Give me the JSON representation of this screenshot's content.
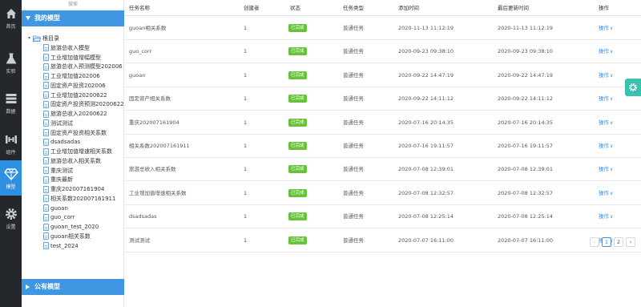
{
  "nav": [
    {
      "label": "首页",
      "icon": "home-icon"
    },
    {
      "label": "实验",
      "icon": "flask-icon"
    },
    {
      "label": "数据",
      "icon": "database-icon"
    },
    {
      "label": "组件",
      "icon": "components-icon"
    },
    {
      "label": "模型",
      "icon": "diamond-icon"
    },
    {
      "label": "设置",
      "icon": "gear-icon"
    }
  ],
  "tree": {
    "search_placeholder": "搜索",
    "my_models_label": "我的模型",
    "root_label": "根目录",
    "nodes": [
      "旅游总收入模型",
      "工业增加值增幅模型",
      "旅游总收入预测模型202006",
      "工业增加值202006",
      "固定资产投资202006",
      "工业增加值20200622",
      "固定资产投资预测20200622",
      "旅游总收入20200622",
      "测试测试",
      "固定资产投资相关系数",
      "dsadsadas",
      "工业增加值增速相关系数",
      "旅游总收入相关系数",
      "重庆测试",
      "重庆最新",
      "重庆202007161904",
      "相关系数202007161911",
      "guoan",
      "guo_corr",
      "guoan_test_2020",
      "guoan相关系数",
      "test_2024"
    ],
    "public_models_label": "公有模型"
  },
  "table": {
    "headers": [
      "任务名称",
      "创建者",
      "状态",
      "任务类型",
      "添加时间",
      "最后更新时间",
      "操作"
    ],
    "rows": [
      {
        "name": "guoan相关系数",
        "creator": "1",
        "status": "已完成",
        "type": "普通任务",
        "added": "2020-11-13 11:12:19",
        "updated": "2020-11-13 11:12:19",
        "op": "操作"
      },
      {
        "name": "guo_corr",
        "creator": "1",
        "status": "已完成",
        "type": "普通任务",
        "added": "2020-09-23 09:38:10",
        "updated": "2020-09-23 09:38:10",
        "op": "操作"
      },
      {
        "name": "guoan",
        "creator": "1",
        "status": "已完成",
        "type": "普通任务",
        "added": "2020-09-22 14:47:19",
        "updated": "2020-09-22 14:47:19",
        "op": "操作"
      },
      {
        "name": "固定资产相关系数",
        "creator": "1",
        "status": "已完成",
        "type": "普通任务",
        "added": "2020-09-22 14:11:12",
        "updated": "2020-09-22 14:11:12",
        "op": "操作"
      },
      {
        "name": "重庆202007161904",
        "creator": "1",
        "status": "已完成",
        "type": "普通任务",
        "added": "2020-07-16 20:14:35",
        "updated": "2020-07-16 20:14:35",
        "op": "操作"
      },
      {
        "name": "相关系数202007161911",
        "creator": "1",
        "status": "已完成",
        "type": "普通任务",
        "added": "2020-07-16 19:11:57",
        "updated": "2020-07-16 19:11:57",
        "op": "操作"
      },
      {
        "name": "旅游总收入相关系数",
        "creator": "1",
        "status": "已完成",
        "type": "普通任务",
        "added": "2020-07-08 12:39:01",
        "updated": "2020-07-08 12:39:01",
        "op": "操作"
      },
      {
        "name": "工业增加值增速相关系数",
        "creator": "1",
        "status": "已完成",
        "type": "普通任务",
        "added": "2020-07-08 12:32:57",
        "updated": "2020-07-08 12:32:57",
        "op": "操作"
      },
      {
        "name": "dsadsadas",
        "creator": "1",
        "status": "已完成",
        "type": "普通任务",
        "added": "2020-07-08 12:25:14",
        "updated": "2020-07-08 12:25:14",
        "op": "操作"
      },
      {
        "name": "测试测试",
        "creator": "1",
        "status": "已完成",
        "type": "普通任务",
        "added": "2020-07-07 16:11:00",
        "updated": "2020-07-07 16:11:00",
        "op": "操作"
      }
    ]
  },
  "pagination": {
    "prev": "‹",
    "pages": [
      "1",
      "2"
    ],
    "next": "›",
    "current": "1"
  },
  "colors": {
    "nav_bg": "#24282d",
    "active_blue": "#2f8fe0",
    "header_blue": "#3f97e3",
    "status_green": "#67c23a",
    "link_blue": "#3a8ee6",
    "float_teal": "#3cc0b2"
  }
}
